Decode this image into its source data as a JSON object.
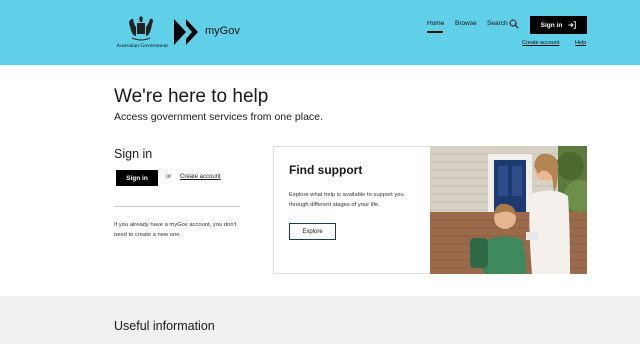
{
  "header": {
    "crest_text": "Australian Government",
    "brand": "myGov",
    "nav": {
      "home": "Home",
      "browse": "Browse",
      "search": "Search"
    },
    "sign_in": "Sign in",
    "create_account": "Create account",
    "help": "Help"
  },
  "hero": {
    "title": "We're here to help",
    "subtitle": "Access government services from one place."
  },
  "signin_section": {
    "heading": "Sign in",
    "button": "Sign in",
    "or": "or",
    "create_account": "Create account",
    "note": "If you already have a myGov account, you don't need to create a new one."
  },
  "support_card": {
    "title": "Find support",
    "text": "Explore what help is available to support you through different stages of your life.",
    "button": "Explore"
  },
  "useful": {
    "title": "Useful information"
  },
  "colors": {
    "header_bg": "#60d0e9",
    "button_bg": "#000000",
    "footer_band": "#eef0f2"
  }
}
